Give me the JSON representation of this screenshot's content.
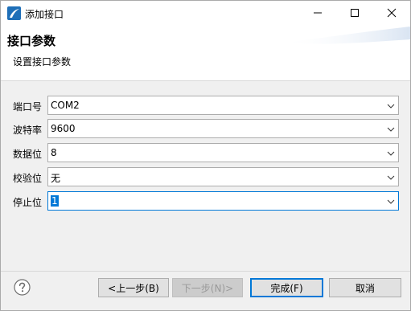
{
  "window": {
    "title": "添加接口"
  },
  "banner": {
    "title": "接口参数",
    "subtitle": "设置接口参数"
  },
  "form": {
    "fields": [
      {
        "label": "端口号",
        "value": "COM2"
      },
      {
        "label": "波特率",
        "value": "9600"
      },
      {
        "label": "数据位",
        "value": "8"
      },
      {
        "label": "校验位",
        "value": "无"
      },
      {
        "label": "停止位",
        "value": "1"
      }
    ]
  },
  "buttons": {
    "back": "<上一步(B)",
    "next": "下一步(N)>",
    "finish": "完成(F)",
    "cancel": "取消"
  },
  "colors": {
    "accent": "#0078d7",
    "dialog_bg": "#f0f0f0",
    "field_border": "#adadad"
  },
  "icons": {
    "app": "eclipse-feather-icon",
    "help": "help-icon",
    "dropdown": "chevron-down-icon"
  }
}
